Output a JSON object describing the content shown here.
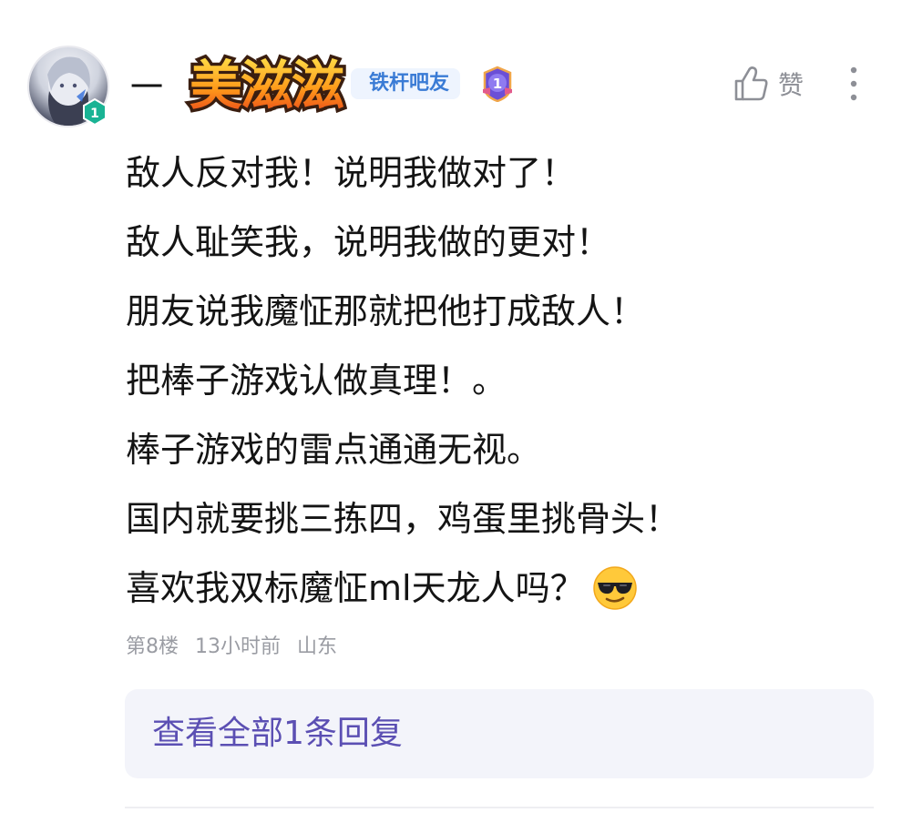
{
  "post": {
    "user": {
      "name_prefix": "一",
      "decorative_title": "美滋滋",
      "level": "1",
      "bar_tag": "铁杆吧友",
      "rank_badge": "1"
    },
    "actions": {
      "like_label": "赞"
    },
    "lines": [
      "敌人反对我！说明我做对了！",
      "敌人耻笑我，说明我做的更对！",
      "朋友说我魔怔那就把他打成敌人！",
      "把棒子游戏认做真理！。",
      "棒子游戏的雷点通通无视。",
      "国内就要挑三拣四，鸡蛋里挑骨头！",
      "喜欢我双标魔怔ml天龙人吗？"
    ],
    "meta": {
      "floor": "第8楼",
      "time": "13小时前",
      "location": "山东"
    },
    "reply_link": "查看全部1条回复"
  },
  "colors": {
    "reply_text": "#5b4fb3",
    "tag_text": "#3a7bd5",
    "tag_bg": "#eef4fe",
    "badge_teal": "#19b394",
    "rank_purple": "#6b4fd6",
    "deco_orange": "#f5a11a"
  },
  "icons": {
    "like": "thumbs-up-icon",
    "more": "vertical-dots-icon",
    "emoji": "sunglasses-emoji"
  }
}
